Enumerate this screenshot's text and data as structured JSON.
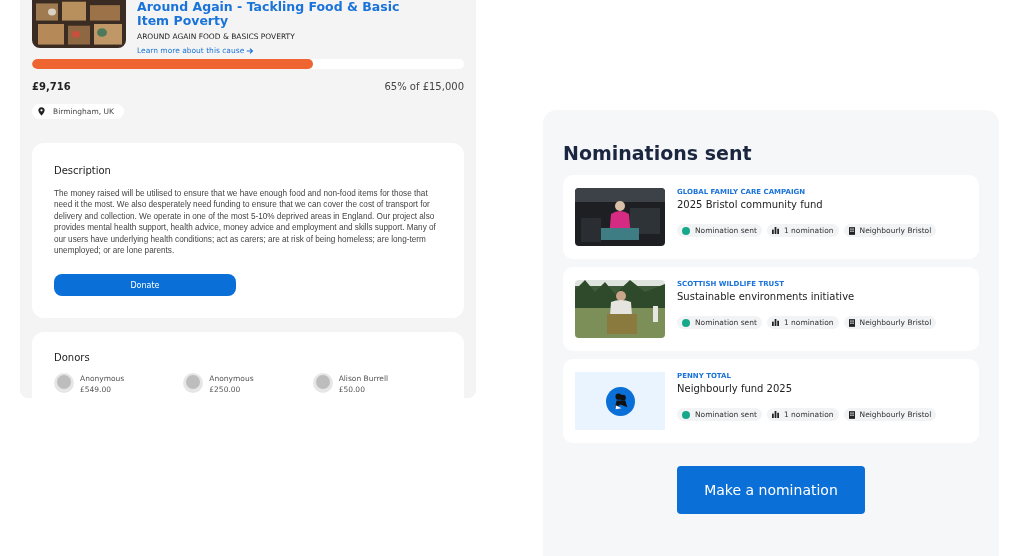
{
  "cause": {
    "title": "Around Again - Tackling Food & Basic Item Poverty",
    "organisation": "AROUND AGAIN FOOD & BASICS POVERTY",
    "link": "Learn more about this cause",
    "progress": {
      "level": 0.65
    },
    "raised": "£9,716",
    "target": "65% of £15,000",
    "location": "Birmingham, UK"
  },
  "description": {
    "heading": "Description",
    "text": "The money raised will be utilised to ensure that we have enough food and non-food items for those that need it the most.   We also desperately need funding to ensure that we can cover the cost of transport for delivery and collection.  We operate in one of the most 5-10% deprived areas in England.  Our project also provides mental health support, health advice, money advice and employment and skills support.  Many of our users have underlying health conditions; act as carers; are at risk of being homeless; are long-term unemployed; or are lone parents.",
    "button": "Donate"
  },
  "donors": {
    "heading": "Donors",
    "items": [
      {
        "name": "Anonymous",
        "amount": "£549.00"
      },
      {
        "name": "Anonymous",
        "amount": "£250.00"
      },
      {
        "name": "Alison Burrell",
        "amount": "£50.00"
      }
    ]
  },
  "nominations": {
    "heading": "Nominations sent",
    "items": [
      {
        "kind": "picture",
        "organisation": "GLOBAL FAMILY CARE CAMPAIGN",
        "title": "2025 Bristol community fund",
        "status": "Nomination sent",
        "count": "1 nomination",
        "network": "Neighbourly Bristol"
      },
      {
        "kind": "picture",
        "organisation": "SCOTTISH WILDLIFE TRUST",
        "title": "Sustainable environments initiative",
        "status": "Nomination sent",
        "count": "1 nomination",
        "network": "Neighbourly Bristol"
      },
      {
        "kind": "logo",
        "organisation": "PENNY TOTAL",
        "title": "Neighbourly fund 2025",
        "status": "Nomination sent",
        "count": "1 nomination",
        "network": "Neighbourly Bristol"
      }
    ],
    "button": "Make a nomination"
  }
}
